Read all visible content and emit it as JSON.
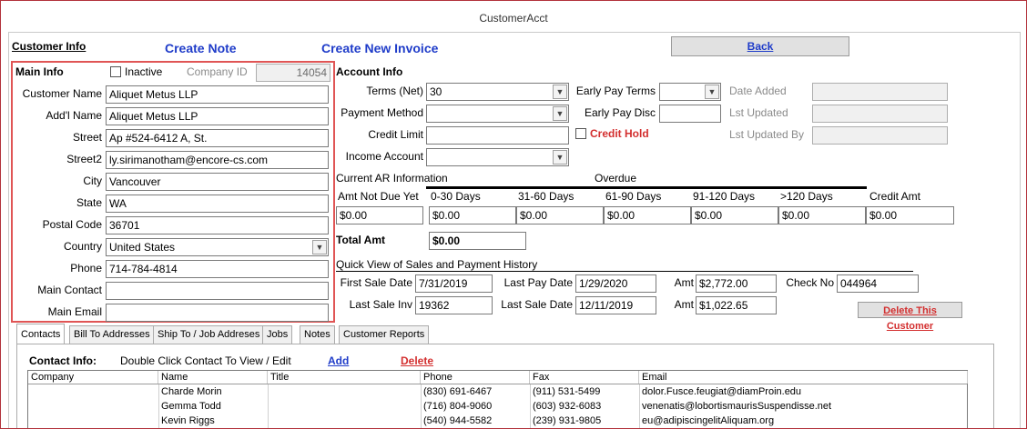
{
  "window": {
    "title": "CustomerAcct"
  },
  "header": {
    "customer_info": "Customer Info",
    "create_note": "Create Note",
    "create_invoice": "Create New Invoice",
    "back": "Back"
  },
  "main_info": {
    "heading": "Main Info",
    "inactive_label": "Inactive",
    "company_id_label": "Company ID",
    "company_id": "14054",
    "fields": [
      {
        "label": "Customer Name",
        "value": "Aliquet Metus LLP"
      },
      {
        "label": "Add'l Name",
        "value": "Aliquet Metus LLP"
      },
      {
        "label": "Street",
        "value": "Ap #524-6412 A, St."
      },
      {
        "label": "Street2",
        "value": "ly.sirimanotham@encore-cs.com"
      },
      {
        "label": "City",
        "value": "Vancouver"
      },
      {
        "label": "State",
        "value": "WA"
      },
      {
        "label": "Postal Code",
        "value": "36701"
      },
      {
        "label": "Country",
        "value": "United States"
      },
      {
        "label": "Phone",
        "value": "714-784-4814"
      },
      {
        "label": "Main Contact",
        "value": ""
      },
      {
        "label": "Main Email",
        "value": ""
      }
    ]
  },
  "account_info": {
    "heading": "Account Info",
    "terms_label": "Terms (Net)",
    "terms": "30",
    "payment_method_label": "Payment Method",
    "payment_method": "",
    "credit_limit_label": "Credit Limit",
    "credit_limit": "",
    "income_account_label": "Income Account",
    "income_account": "",
    "early_pay_terms_label": "Early Pay Terms",
    "early_pay_terms": "",
    "early_pay_disc_label": "Early Pay Disc",
    "early_pay_disc": "",
    "credit_hold_label": "Credit Hold",
    "date_added_label": "Date Added",
    "date_added": "",
    "lst_updated_label": "Lst Updated",
    "lst_updated": "",
    "lst_updated_by_label": "Lst Updated By",
    "lst_updated_by": ""
  },
  "ar": {
    "heading": "Current AR Information",
    "overdue_label": "Overdue",
    "columns": [
      {
        "label": "Amt Not Due Yet",
        "value": "$0.00"
      },
      {
        "label": "0-30 Days",
        "value": "$0.00"
      },
      {
        "label": "31-60 Days",
        "value": "$0.00"
      },
      {
        "label": "61-90 Days",
        "value": "$0.00"
      },
      {
        "label": "91-120 Days",
        "value": "$0.00"
      },
      {
        "label": ">120 Days",
        "value": "$0.00"
      },
      {
        "label": "Credit Amt",
        "value": "$0.00"
      }
    ],
    "total_label": "Total Amt",
    "total": "$0.00"
  },
  "history": {
    "heading": "Quick View of Sales and Payment History",
    "first_sale_date_label": "First Sale Date",
    "first_sale_date": "7/31/2019",
    "last_pay_date_label": "Last Pay Date",
    "last_pay_date": "1/29/2020",
    "amt1_label": "Amt",
    "amt1": "$2,772.00",
    "check_no_label": "Check No",
    "check_no": "044964",
    "last_sale_inv_label": "Last Sale Inv",
    "last_sale_inv": "19362",
    "last_sale_date_label": "Last Sale Date",
    "last_sale_date": "12/11/2019",
    "amt2_label": "Amt",
    "amt2": "$1,022.65",
    "delete_customer": "Delete This Customer"
  },
  "tabs": [
    "Contacts",
    "Bill To Addresses",
    "Ship To / Job Addreses",
    "Jobs",
    "Notes",
    "Customer Reports"
  ],
  "contacts": {
    "heading": "Contact Info:",
    "hint": "Double Click Contact To View / Edit",
    "add": "Add",
    "delete": "Delete",
    "columns": [
      "Company",
      "Name",
      "Title",
      "Phone",
      "Fax",
      "Email"
    ],
    "rows": [
      {
        "company": "",
        "name": "Charde Morin",
        "title": "",
        "phone": "(830) 691-6467",
        "fax": "(911) 531-5499",
        "email": "dolor.Fusce.feugiat@diamProin.edu"
      },
      {
        "company": "",
        "name": "Gemma Todd",
        "title": "",
        "phone": "(716) 804-9060",
        "fax": "(603) 932-6083",
        "email": "venenatis@lobortismaurisSuspendisse.net"
      },
      {
        "company": "",
        "name": "Kevin Riggs",
        "title": "",
        "phone": "(540) 944-5582",
        "fax": "(239) 931-9805",
        "email": "eu@adipiscingelitAliquam.org"
      }
    ]
  },
  "colors": {
    "accent_blue": "#1f3cc9",
    "alert_red": "#d32f2f",
    "highlight_border": "#e05555"
  }
}
